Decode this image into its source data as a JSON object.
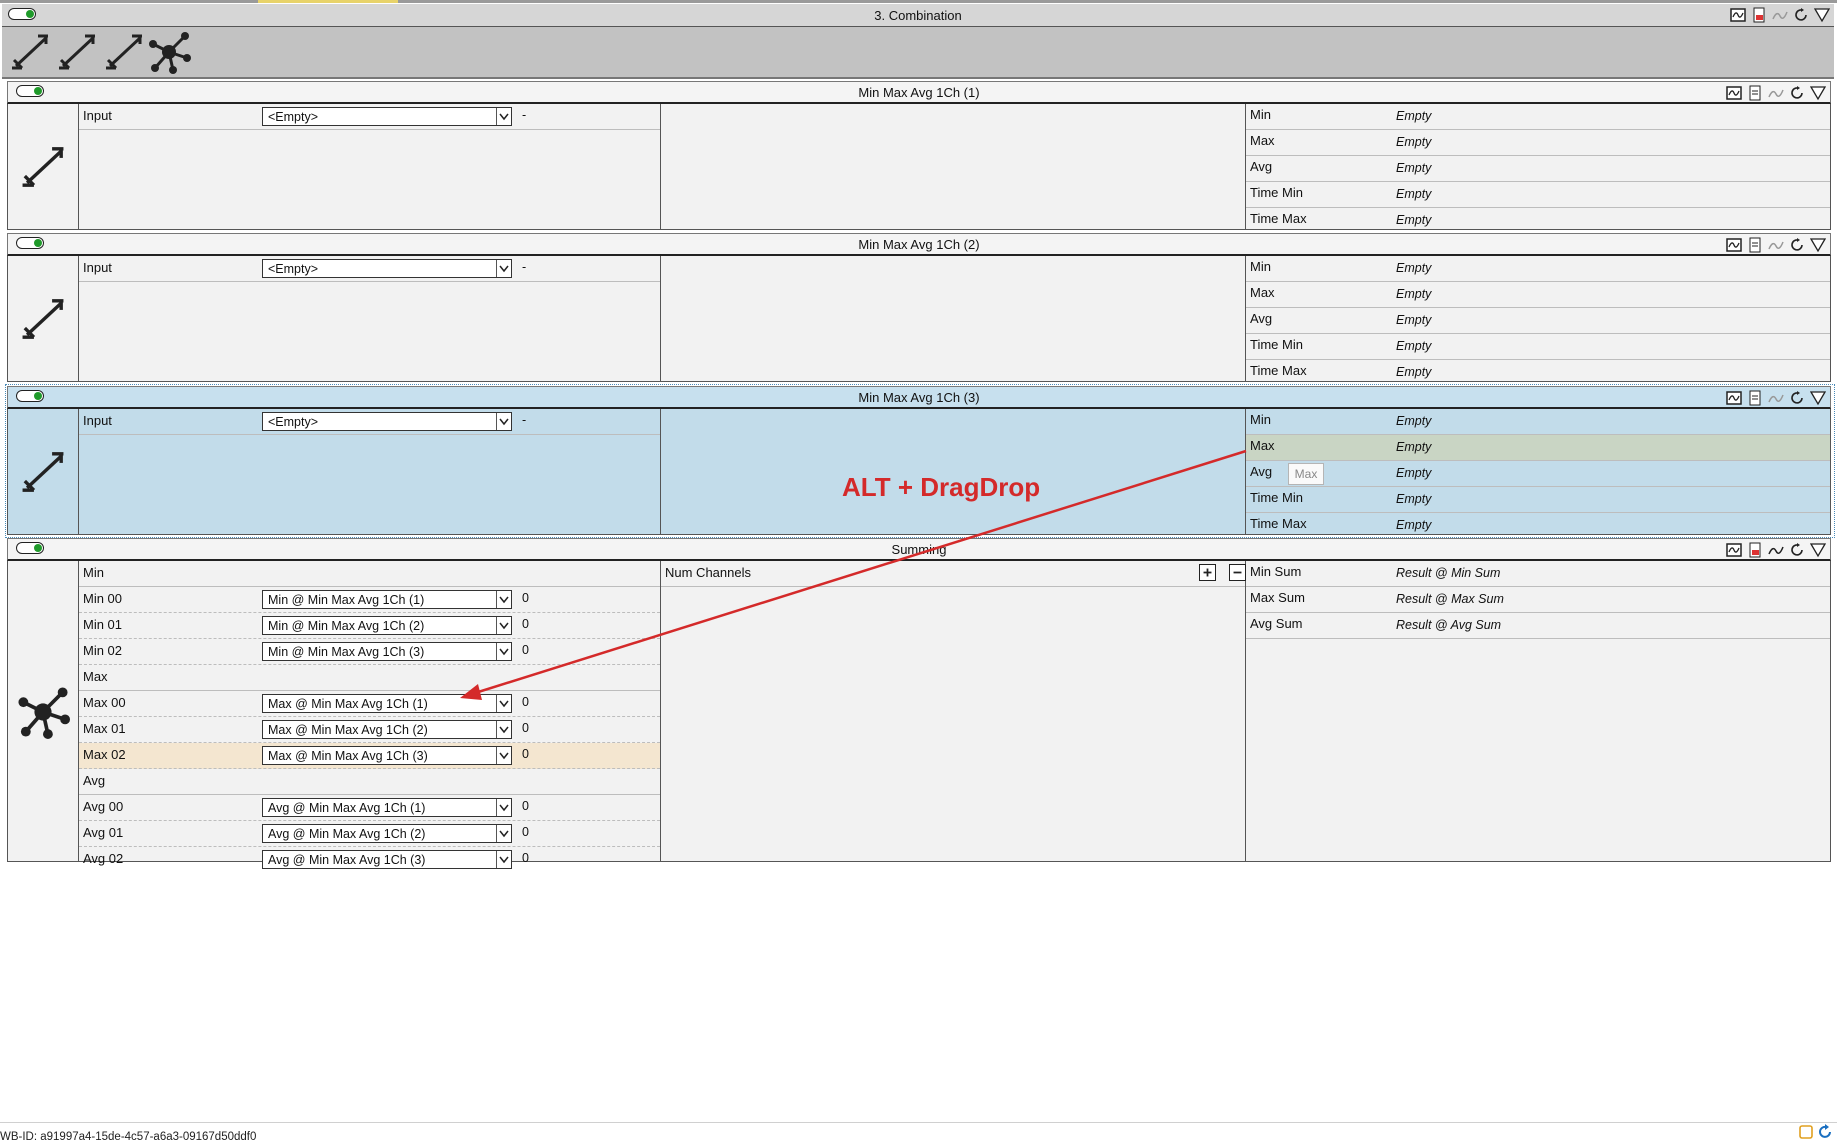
{
  "workbook": {
    "title": "3. Combination",
    "wb_id": "WB-ID: a91997a4-15de-4c57-a6a3-09167d50ddf0"
  },
  "modules": [
    {
      "title": "Min Max Avg 1Ch (1)",
      "input_label": "Input",
      "input_value": "<Empty>",
      "input_suffix": "-",
      "outputs": [
        {
          "label": "Min",
          "value": "Empty"
        },
        {
          "label": "Max",
          "value": "Empty"
        },
        {
          "label": "Avg",
          "value": "Empty"
        },
        {
          "label": "Time Min",
          "value": "Empty"
        },
        {
          "label": "Time Max",
          "value": "Empty"
        }
      ]
    },
    {
      "title": "Min Max Avg 1Ch (2)",
      "input_label": "Input",
      "input_value": "<Empty>",
      "input_suffix": "-",
      "outputs": [
        {
          "label": "Min",
          "value": "Empty"
        },
        {
          "label": "Max",
          "value": "Empty"
        },
        {
          "label": "Avg",
          "value": "Empty"
        },
        {
          "label": "Time Min",
          "value": "Empty"
        },
        {
          "label": "Time Max",
          "value": "Empty"
        }
      ]
    },
    {
      "title": "Min Max Avg 1Ch (3)",
      "input_label": "Input",
      "input_value": "<Empty>",
      "input_suffix": "-",
      "outputs": [
        {
          "label": "Min",
          "value": "Empty"
        },
        {
          "label": "Max",
          "value": "Empty"
        },
        {
          "label": "Avg",
          "value": "Empty"
        },
        {
          "label": "Time Min",
          "value": "Empty"
        },
        {
          "label": "Time Max",
          "value": "Empty"
        }
      ],
      "drag_tooltip": "Max",
      "annotation": "ALT + DragDrop"
    }
  ],
  "summing": {
    "title": "Summing",
    "num_channels_label": "Num Channels",
    "groups": [
      {
        "label": "Min",
        "rows": [
          {
            "label": "Min 00",
            "value": "Min @ Min Max Avg 1Ch (1)",
            "num": "0"
          },
          {
            "label": "Min 01",
            "value": "Min @ Min Max Avg 1Ch (2)",
            "num": "0"
          },
          {
            "label": "Min 02",
            "value": "Min @ Min Max Avg 1Ch (3)",
            "num": "0"
          }
        ]
      },
      {
        "label": "Max",
        "rows": [
          {
            "label": "Max 00",
            "value": "Max @ Min Max Avg 1Ch (1)",
            "num": "0"
          },
          {
            "label": "Max 01",
            "value": "Max @ Min Max Avg 1Ch (2)",
            "num": "0"
          },
          {
            "label": "Max 02",
            "value": "Max @ Min Max Avg 1Ch (3)",
            "num": "0"
          }
        ]
      },
      {
        "label": "Avg",
        "rows": [
          {
            "label": "Avg 00",
            "value": "Avg @ Min Max Avg 1Ch (1)",
            "num": "0"
          },
          {
            "label": "Avg 01",
            "value": "Avg @ Min Max Avg 1Ch (2)",
            "num": "0"
          },
          {
            "label": "Avg 02",
            "value": "Avg @ Min Max Avg 1Ch (3)",
            "num": "0"
          }
        ]
      }
    ],
    "outputs": [
      {
        "label": "Min Sum",
        "value": "Result @ Min Sum"
      },
      {
        "label": "Max Sum",
        "value": "Result @ Max Sum"
      },
      {
        "label": "Avg Sum",
        "value": "Result @ Avg Sum"
      }
    ]
  },
  "colors": {
    "accent_green": "#1f9a2a",
    "selected_bg": "#c2dcea",
    "annotation_red": "#d42a2a",
    "highlight_row": "#f4e6d0"
  },
  "icons": [
    "toggle-icon",
    "chart-icon",
    "save-icon",
    "signal-icon",
    "refresh-icon",
    "filter-icon",
    "min-max-module-icon",
    "summing-module-icon"
  ]
}
